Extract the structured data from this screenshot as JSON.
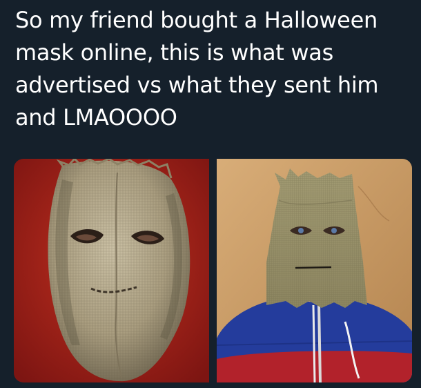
{
  "tweet": {
    "text_lines": [
      "So my friend bought a Halloween",
      "mask online, this is what was",
      "advertised vs what they sent him",
      "and LMAOOOO"
    ]
  },
  "media": {
    "left_photo": {
      "icon": "burlap-mask-advertised-image"
    },
    "right_photo": {
      "icon": "paper-bag-mask-received-image"
    }
  },
  "colors": {
    "background": "#15202b",
    "text": "#ffffff",
    "left_backdrop": "#a8241c",
    "right_backdrop": "#c99a66",
    "jacket_blue": "#243c9c",
    "jacket_red": "#b2222b"
  }
}
